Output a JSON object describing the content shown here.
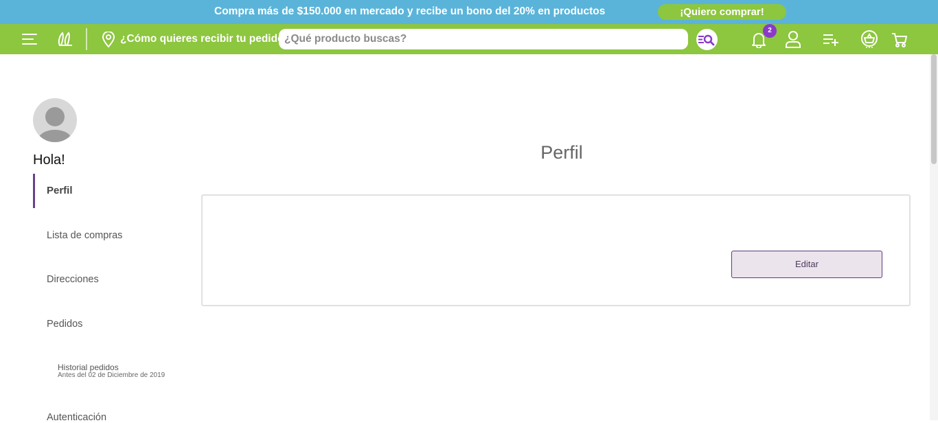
{
  "promo": {
    "text": "Compra más de $150.000 en mercado y recibe un bono del 20% en productos",
    "button_label": "¡Quiero comprar!"
  },
  "header": {
    "delivery_label": "¿Cómo quieres recibir tu pedido?",
    "search_placeholder": "¿Qué producto buscas?",
    "notification_count": "2",
    "icons": [
      "menu-icon",
      "logo-icon",
      "location-pin-icon",
      "smart-search-icon",
      "bell-icon",
      "user-icon",
      "shopping-list-icon",
      "basket-icon",
      "cart-icon"
    ]
  },
  "sidebar": {
    "greeting": "Hola!",
    "items": [
      {
        "label": "Perfil",
        "active": true
      },
      {
        "label": "Lista de compras"
      },
      {
        "label": "Direcciones"
      },
      {
        "label": "Pedidos"
      },
      {
        "label": "Autenticación"
      }
    ],
    "sub_item": {
      "title": "Historial pedidos",
      "note": "Antes del 02 de Diciembre de 2019"
    }
  },
  "main": {
    "title": "Perfil",
    "edit_label": "Editar"
  },
  "colors": {
    "promo_bg": "#5ab4d9",
    "header_bg": "#8dc63f",
    "accent_purple": "#6b3f8e",
    "badge": "#8a3ac9"
  }
}
